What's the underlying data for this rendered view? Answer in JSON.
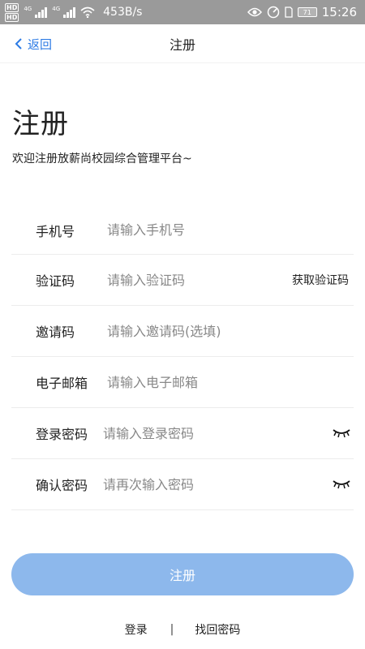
{
  "status_bar": {
    "hd1": "HD",
    "hd2": "HD",
    "net1": "4G",
    "net2": "4G",
    "speed": "453B/s",
    "battery": "71",
    "time": "15:26"
  },
  "nav": {
    "back_label": "返回",
    "title": "注册"
  },
  "heading": {
    "title": "注册",
    "subtitle": "欢迎注册放薪尚校园综合管理平台~"
  },
  "form": {
    "phone": {
      "label": "手机号",
      "placeholder": "请输入手机号"
    },
    "code": {
      "label": "验证码",
      "placeholder": "请输入验证码",
      "action": "获取验证码"
    },
    "invite": {
      "label": "邀请码",
      "placeholder": "请输入邀请码(选填)"
    },
    "email": {
      "label": "电子邮箱",
      "placeholder": "请输入电子邮箱"
    },
    "password": {
      "label": "登录密码",
      "placeholder": "请输入登录密码"
    },
    "confirm": {
      "label": "确认密码",
      "placeholder": "请再次输入密码"
    }
  },
  "register_button": "注册",
  "footer": {
    "login": "登录",
    "separator": "|",
    "recover": "找回密码"
  },
  "colors": {
    "accent": "#2d7be5",
    "button": "#8db8ec",
    "status_bar": "#9a9a9a"
  }
}
